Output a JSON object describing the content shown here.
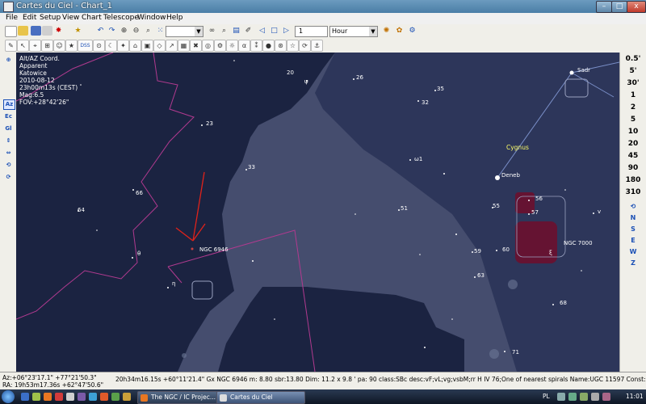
{
  "window": {
    "title": "Cartes du Ciel - Chart_1",
    "min": "–",
    "max": "□",
    "close": "x"
  },
  "menu": [
    "File",
    "Edit",
    "Setup",
    "View",
    "Chart",
    "Telescope",
    "Window",
    "Help"
  ],
  "toolbar1": {
    "icons": [
      "new-icon",
      "open-icon",
      "save-icon",
      "print-icon",
      "connect-icon",
      "undo-icon",
      "redo-icon",
      "zoom-in-icon",
      "zoom-out-icon",
      "zoom-fit-icon"
    ],
    "combo_value": "",
    "find_icons": [
      "binoculars-icon",
      "search-icon",
      "save-list-icon",
      "mark-icon"
    ],
    "nav_icons": [
      "prev-icon",
      "stop-icon",
      "next-icon"
    ],
    "step_value": "1",
    "time_unit": "Hour",
    "extra_icons": [
      "animation-icon",
      "refresh-icon"
    ]
  },
  "toolbar2": {
    "buttons": [
      "✎",
      "↖",
      "⌖",
      "⊞",
      "☺",
      "★",
      "DSS",
      "⊙",
      "☾",
      "✦",
      "⌂",
      "▣",
      "◇",
      "↗",
      "▦",
      "✖",
      "◎",
      "⚙",
      "☼",
      "α",
      "⁑",
      "●",
      "⊛",
      "☆",
      "⟳",
      "⚓"
    ]
  },
  "left_toolbar": [
    "⊕",
    "Az",
    "Ec",
    "Gl",
    "⇕",
    "⇔",
    "⟲",
    "⟳"
  ],
  "right_toolbar": {
    "fov": [
      "0.5'",
      "5'",
      "30'",
      "1",
      "2",
      "5",
      "10",
      "20",
      "45",
      "90",
      "180",
      "310"
    ],
    "icons": [
      "⟲",
      "N",
      "S",
      "E",
      "W",
      "Z"
    ]
  },
  "chart_info": [
    "Alt/AZ Coord.",
    "Apparent",
    "Katowice",
    "2010-08-12",
    "23h00m13s (CEST)",
    "Mag:6.5",
    "FOV:+28°42'26\""
  ],
  "star_labels": [
    {
      "text": "20"
    },
    {
      "text": "ψ"
    },
    {
      "text": "26"
    },
    {
      "text": "35"
    },
    {
      "text": "32"
    },
    {
      "text": "ω1"
    },
    {
      "text": "23"
    },
    {
      "text": "33"
    },
    {
      "text": "66"
    },
    {
      "text": "64"
    },
    {
      "text": "θ"
    },
    {
      "text": "η"
    },
    {
      "text": "51"
    },
    {
      "text": "55"
    },
    {
      "text": "56"
    },
    {
      "text": "57"
    },
    {
      "text": "59"
    },
    {
      "text": "60"
    },
    {
      "text": "ξ"
    },
    {
      "text": "63"
    },
    {
      "text": "68"
    },
    {
      "text": "71"
    },
    {
      "text": "v"
    },
    {
      "text": "Sadr"
    },
    {
      "text": "Deneb"
    }
  ],
  "constellation_label": "Cygnus",
  "object_labels": {
    "ngc6946": "NGC 6946",
    "ngc7000": "NGC 7000"
  },
  "colors": {
    "sky": "#1b2341",
    "milkyway": "#4a5273",
    "boundary": "#b03a8f",
    "arrow": "#e0221a",
    "nebula": "#6b0f2e"
  },
  "status": {
    "coord_line1": "Az:+06°23'17.1\" +77°21'50.3\"",
    "coord_line2": "RA: 19h53m17.36s +62°47'50.6\"",
    "object_info": "20h34m16.15s +60°11'21.4\"  Gx NGC 6946 m: 8.80 sbr:13.80 Dim: 11.2 x 9.8 ' pa: 90 class:SBc desc:vF;vL;vg;vsbM;rr H IV 76;One of nearest spirals Name:UGC 11597 Const:CEP"
  },
  "taskbar": {
    "buttons": [
      "The NGC / IC Projec...",
      "Cartes du Ciel"
    ],
    "lang": "PL",
    "clock": "11:01"
  }
}
